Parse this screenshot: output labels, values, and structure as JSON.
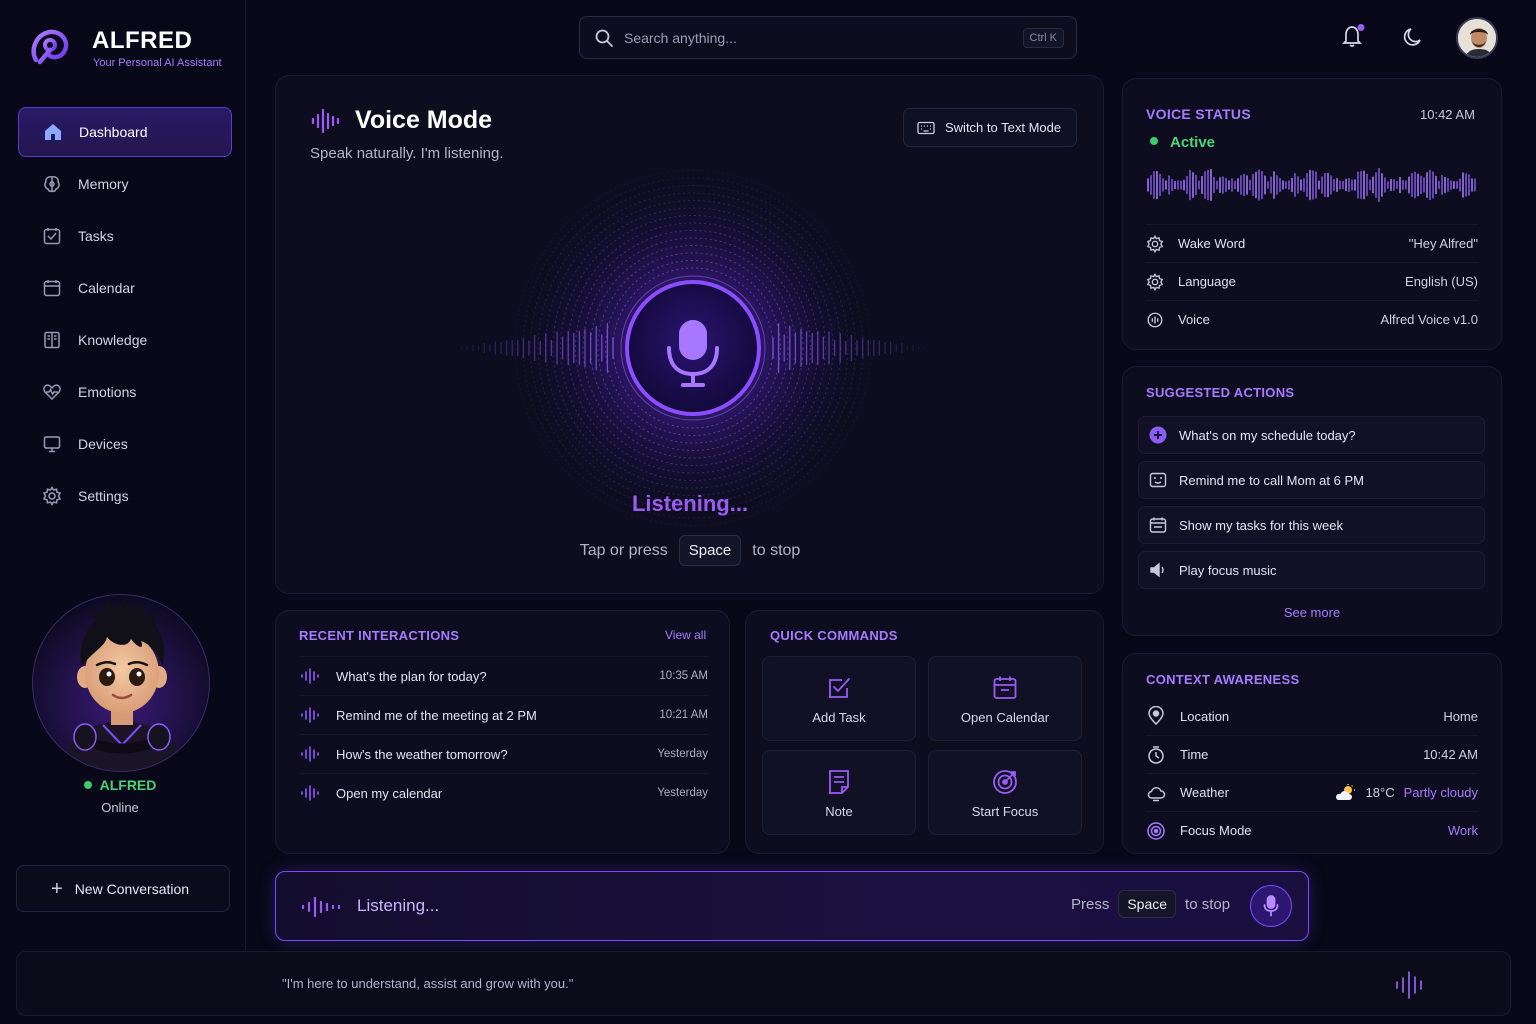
{
  "brand": {
    "name": "ALFRED",
    "tagline": "Your Personal AI Assistant"
  },
  "search": {
    "placeholder": "Search anything...",
    "shortcut": "Ctrl K"
  },
  "sidebar": {
    "items": [
      {
        "label": "Dashboard",
        "icon": "home-icon",
        "active": true
      },
      {
        "label": "Memory",
        "icon": "brain-icon"
      },
      {
        "label": "Tasks",
        "icon": "checkbox-icon"
      },
      {
        "label": "Calendar",
        "icon": "calendar-icon"
      },
      {
        "label": "Knowledge",
        "icon": "book-icon"
      },
      {
        "label": "Emotions",
        "icon": "heart-icon"
      },
      {
        "label": "Devices",
        "icon": "monitor-icon"
      },
      {
        "label": "Settings",
        "icon": "gear-icon"
      }
    ],
    "assistant": {
      "name": "ALFRED",
      "status": "Online"
    },
    "new_conversation": "New Conversation"
  },
  "voice_mode": {
    "title": "Voice Mode",
    "subtitle": "Speak naturally. I'm listening.",
    "switch_label": "Switch to Text Mode",
    "listening": "Listening...",
    "hint_prefix": "Tap or press",
    "hint_key": "Space",
    "hint_suffix": "to stop"
  },
  "recent": {
    "title": "RECENT INTERACTIONS",
    "view_all": "View all",
    "items": [
      {
        "text": "What's the plan for today?",
        "time": "10:35 AM"
      },
      {
        "text": "Remind me of the meeting at 2 PM",
        "time": "10:21 AM"
      },
      {
        "text": "How's the weather tomorrow?",
        "time": "Yesterday"
      },
      {
        "text": "Open my calendar",
        "time": "Yesterday"
      }
    ]
  },
  "quick_commands": {
    "title": "QUICK COMMANDS",
    "items": [
      "Add Task",
      "Open Calendar",
      "Note",
      "Start Focus"
    ]
  },
  "voice_status": {
    "title": "VOICE STATUS",
    "time": "10:42 AM",
    "state": "Active",
    "rows": [
      {
        "label": "Wake Word",
        "value": "\"Hey Alfred\""
      },
      {
        "label": "Language",
        "value": "English (US)"
      },
      {
        "label": "Voice",
        "value": "Alfred Voice v1.0"
      }
    ]
  },
  "suggested": {
    "title": "SUGGESTED ACTIONS",
    "items": [
      "What's on my schedule today?",
      "Remind me to call Mom at 6 PM",
      "Show my tasks for this week",
      "Play focus music"
    ],
    "see_more": "See more"
  },
  "context": {
    "title": "CONTEXT AWARENESS",
    "rows": [
      {
        "label": "Location",
        "value": "Home"
      },
      {
        "label": "Time",
        "value": "10:42 AM"
      },
      {
        "label": "Weather",
        "temp": "18°C",
        "value": "Partly cloudy"
      },
      {
        "label": "Focus Mode",
        "value": "Work"
      }
    ]
  },
  "listen_bar": {
    "text": "Listening...",
    "press": "Press",
    "key": "Space",
    "suffix": "to stop"
  },
  "footer": {
    "quote": "\"I'm here to understand, assist and grow with you.\""
  },
  "colors": {
    "accent": "#8b5cf6",
    "active": "#3ccc6c",
    "bg": "#080818"
  }
}
